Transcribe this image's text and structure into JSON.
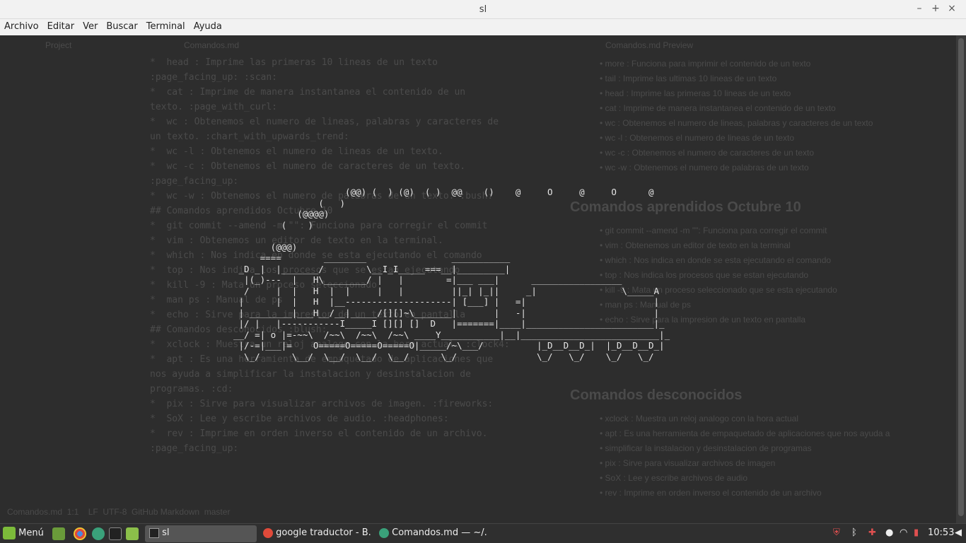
{
  "window": {
    "title": "sl",
    "minimize": "–",
    "maximize": "+",
    "close": "×"
  },
  "menu": [
    "Archivo",
    "Editar",
    "Ver",
    "Buscar",
    "Terminal",
    "Ayuda"
  ],
  "background": {
    "left_panel": [
      "Project",
      "Comandos.md"
    ],
    "editor_lines": [
      "*  head : Imprime las primeras 10 lineas de un texto",
      ":page_facing_up: :scan:",
      "*  cat : Imprime de manera instantanea el contenido de un",
      "texto. :page_with_curl:",
      "*  wc : Obtenemos el numero de lineas, palabras y caracteres de",
      "un texto. :chart_with_upwards_trend:",
      "*  wc -l : Obtenemos el numero de lineas de un texto.",
      "*  wc -c : Obtenemos el numero de caracteres de un texto.",
      ":page_facing_up:",
      "*  wc -w : Obtenemos el numero de palabras de un texto. :bush:",
      "",
      "## Comandos aprendidos Octubre 10",
      "*  git commit --amend -m \"\": Funciona para corregir el commit",
      "*  vim : Obtenemos un editor de texto en la terminal.",
      "*  which : Nos indica en donde se esta ejecutando el comando",
      "*  top : Nos indica los procesos que se estan ejecutando",
      "*  kill -9 : Mata un proceso seleccionado",
      "*  man ps : Manual de ps",
      "*  echo : Sirve para la impresion de un texto en pantalla",
      "",
      "## Comandos desconocidos :blush:",
      "*  xclock : Muestra un reloj analogo con la hora actual. :clock4:",
      "*  apt : Es una herramienta de empaquetado de aplicaciones que",
      "nos ayuda a simplificar la instalacion y desinstalacion de",
      "programas. :cd:",
      "*  pix : Sirve para visualizar archivos de imagen. :fireworks:",
      "*  SoX : Lee y escribe archivos de audio. :headphones:",
      "*  rev : Imprime en orden inverso el contenido de un archivo.",
      ":page_facing_up:"
    ],
    "preview_title": "Comandos.md Preview",
    "preview_lines": [
      "more : Funciona para imprimir el contenido de un texto",
      "tail : Imprime las ultimas 10 lineas de un texto",
      "head : Imprime las primeras 10 lineas de un texto",
      "cat : Imprime de manera instantanea el contenido de un texto",
      "wc : Obtenemos el numero de lineas, palabras y caracteres de un texto",
      "wc -l : Obtenemos el numero de lineas de un texto",
      "wc -c : Obtenemos el numero de caracteres de un texto",
      "wc -w : Obtenemos el numero de palabras de un texto"
    ],
    "preview_heading1": "Comandos aprendidos Octubre 10",
    "preview_lines2": [
      "git commit --amend -m \"\": Funciona para corregir el commit",
      "vim : Obtenemos un editor de texto en la terminal",
      "which : Nos indica en donde se esta ejecutando el comando",
      "top : Nos indica los procesos que se estan ejecutando",
      "kill -9 : Mata un proceso seleccionado que se esta ejecutando",
      "man ps : Manual de ps",
      "echo : Sirve para la impresion de un texto en pantalla"
    ],
    "preview_heading2": "Comandos desconocidos",
    "preview_lines3": [
      "xclock : Muestra un reloj analogo con la hora actual",
      "apt : Es una herramienta de empaquetado de aplicaciones que nos ayuda a",
      "simplificar la instalacion y desinstalacion de programas",
      "pix : Sirve para visualizar archivos de imagen",
      "SoX : Lee y escribe archivos de audio",
      "rev : Imprime en orden inverso el contenido de un archivo"
    ],
    "statusbar": "Comandos.md  1:1    LF  UTF-8  GitHub Markdown  master"
  },
  "train_ascii": "                     (@@) (  ) (@)  ( )  @@    ()    @     O     @     O      @\n                (   )\n            (@@@@)\n         (    )\n\n       (@@@)\n     ====        ________                ___________\n _D _|  |_______/        \\__I_I_____===__|_________|\n  |(_)---  |   H\\________/ |   |        =|___ ___|      _________________\n  /     |  |   H  |  |     |   |         ||_| |_||     _|                \\_____A\n |      |  |   H  |__--------------------| [___] |   =|                        |\n | ________|___H__/__|_____/[][]~\\_______|       |   -|                        |\n |/ |   |-----------I_____I [][] []  D   |=======|____|________________________|_\n__/ =| o |=-~~\\  /~~\\  /~~\\  /~~\\ ____Y___________|__|__________________________|_\n |/-=|___|=    O=====O=====O=====O|_____/~\\___/          |_D__D__D_|  |_D__D__D_|\n  \\_/      \\__/  \\__/  \\__/  \\__/      \\_/               \\_/   \\_/    \\_/   \\_/",
  "taskbar": {
    "menu_label": "Menú",
    "tasks": [
      "sl",
      "google traductor - B...",
      "Comandos.md — ~/..."
    ],
    "clock": "10:53"
  },
  "colors": {
    "terminal_bg": "#2d2d2d",
    "terminal_fg": "#e6e6e6",
    "dim_text": "#4b4b4b"
  }
}
